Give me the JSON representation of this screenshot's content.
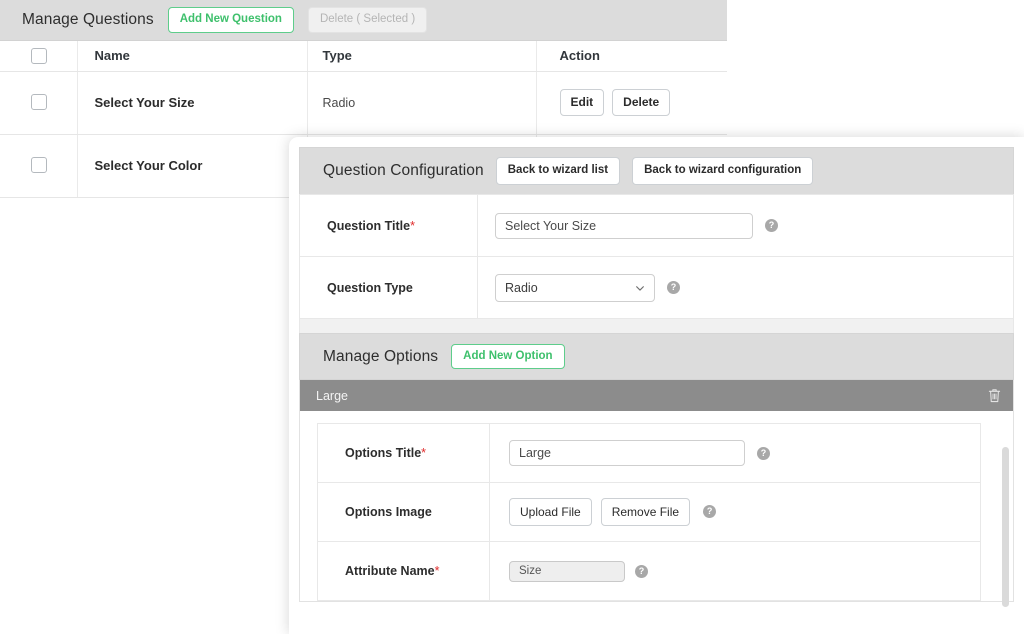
{
  "questions_panel": {
    "title": "Manage Questions",
    "add_button": "Add New Question",
    "delete_button": "Delete ( Selected )",
    "columns": [
      "Name",
      "Type",
      "Action"
    ],
    "rows": [
      {
        "name": "Select Your Size",
        "type": "Radio",
        "edit": "Edit",
        "delete": "Delete"
      },
      {
        "name": "Select Your Color",
        "type": "",
        "edit": "",
        "delete": ""
      }
    ]
  },
  "modal": {
    "title": "Question Configuration",
    "back_to_wizard_list": "Back to wizard list",
    "back_to_wizard_configuration": "Back to wizard configuration",
    "fields": {
      "question_title_label": "Question Title",
      "question_title_value": "Select Your Size",
      "question_type_label": "Question Type",
      "question_type_value": "Radio",
      "question_type_options": [
        "Radio"
      ]
    },
    "options_section": {
      "title": "Manage Options",
      "add_option_button": "Add New Option",
      "option_bar_label": "Large",
      "rows": {
        "options_title_label": "Options Title",
        "options_title_value": "Large",
        "options_image_label": "Options Image",
        "upload_button": "Upload File",
        "remove_button": "Remove File",
        "attribute_name_label": "Attribute Name",
        "attribute_name_value": "Size"
      }
    }
  },
  "colors": {
    "accent_green": "#3ec06c",
    "header_gray": "#dcdcdc",
    "option_bar_gray": "#8c8c8c",
    "required_red": "#e02b2b"
  }
}
